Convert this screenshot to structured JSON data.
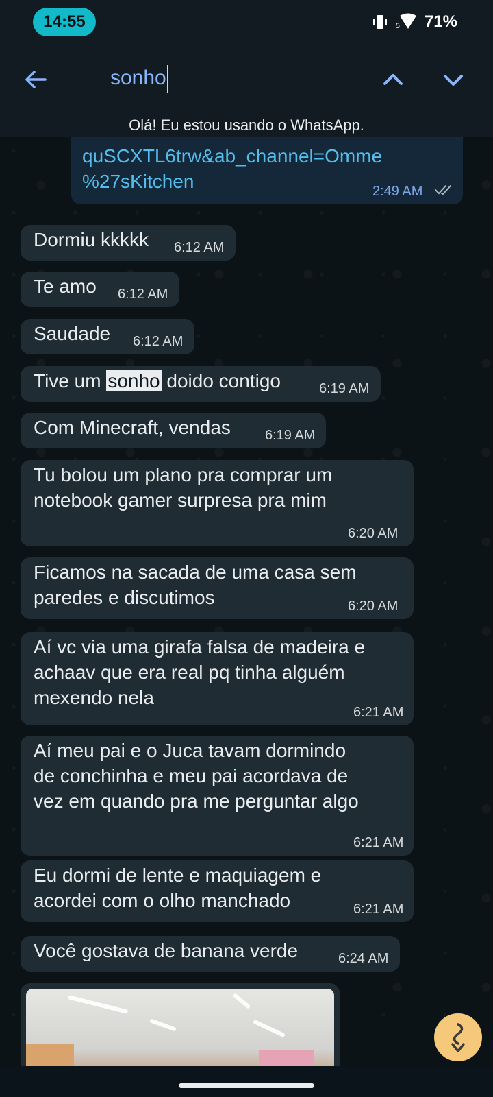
{
  "status_bar": {
    "time": "14:55",
    "signal_badge": "5",
    "battery": "71%"
  },
  "search": {
    "query": "sonho",
    "back_icon": "arrow-left-icon",
    "prev_icon": "chevron-up-icon",
    "next_icon": "chevron-down-icon"
  },
  "contact_status": "Olá! Eu estou usando o WhatsApp.",
  "outgoing_link": {
    "line1": "quSCXTL6trw&ab_channel=Omme",
    "line2": "%27sKitchen",
    "time": "2:49 AM"
  },
  "messages": [
    {
      "text": "Dormiu kkkkk",
      "time": "6:12 AM"
    },
    {
      "text": "Te amo",
      "time": "6:12 AM"
    },
    {
      "text": "Saudade",
      "time": "6:12 AM"
    },
    {
      "before": "Tive um ",
      "highlight": "sonho",
      "after": " doido contigo",
      "time": "6:19 AM"
    },
    {
      "text": "Com Minecraft, vendas",
      "time": "6:19 AM"
    },
    {
      "text": "Tu bolou um plano pra comprar um\nnotebook gamer surpresa pra mim",
      "time": "6:20 AM"
    },
    {
      "text": "Ficamos na sacada de uma casa sem\nparedes e discutimos",
      "time": "6:20 AM"
    },
    {
      "text": "Aí vc via uma girafa falsa de madeira e\nachaav que era real pq tinha alguém\nmexendo nela",
      "time": "6:21 AM"
    },
    {
      "text": "Aí meu pai e o Juca tavam dormindo\nde conchinha e meu pai acordava de\nvez em quando pra me perguntar algo",
      "time": "6:21 AM"
    },
    {
      "text": "Eu dormi de lente e maquiagem e\nacordei com o olho manchado",
      "time": "6:21 AM"
    },
    {
      "text": "Você gostava de banana verde",
      "time": "6:24 AM"
    }
  ],
  "fab_icon": "scroll-down-arrow-icon",
  "colors": {
    "accent": "#8ab4f8",
    "bubble_in": "#202c33",
    "time_pill": "#11b9c9",
    "highlight_bg": "#e9edef"
  }
}
